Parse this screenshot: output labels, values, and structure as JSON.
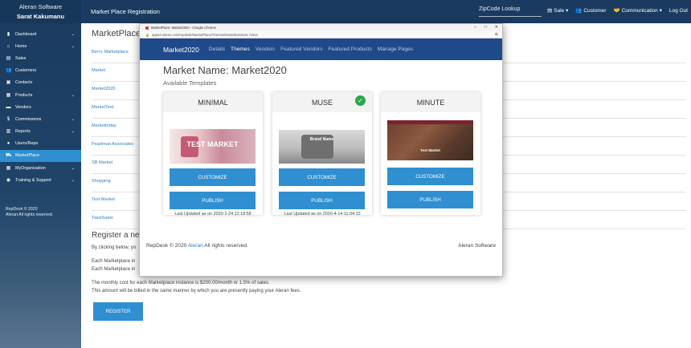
{
  "sidebar": {
    "app_name": "Aleran Software",
    "user_name": "Sarat Kakumanu",
    "items": [
      {
        "label": "Dashboard",
        "icon": "bar-chart-icon",
        "chevron": true
      },
      {
        "label": "Home",
        "icon": "home-icon",
        "chevron": true
      },
      {
        "label": "Sales",
        "icon": "document-icon",
        "chevron": false
      },
      {
        "label": "Customers",
        "icon": "users-icon",
        "chevron": false
      },
      {
        "label": "Contacts",
        "icon": "contact-icon",
        "chevron": false
      },
      {
        "label": "Products",
        "icon": "box-icon",
        "chevron": true
      },
      {
        "label": "Vendors",
        "icon": "truck-icon",
        "chevron": false
      },
      {
        "label": "Commissions",
        "icon": "dollar-icon",
        "chevron": true
      },
      {
        "label": "Reports",
        "icon": "reports-icon",
        "chevron": true
      },
      {
        "label": "Users/Reps",
        "icon": "user-icon",
        "chevron": false
      },
      {
        "label": "MarketPlace",
        "icon": "cart-icon",
        "chevron": false,
        "active": true
      },
      {
        "label": "MyOrganization",
        "icon": "building-icon",
        "chevron": true
      },
      {
        "label": "Training & Support",
        "icon": "support-icon",
        "chevron": true
      }
    ],
    "footer_line1": "RepDesk © 2020",
    "footer_line2": "Aleran All rights reserved."
  },
  "topbar": {
    "title": "Market Place Registration",
    "search_value": "ZipCode Lookup",
    "menu": {
      "sale": "Sale",
      "customer": "Customer",
      "communication": "Communication",
      "logout": "Log Out"
    }
  },
  "background": {
    "title": "MarketPlaces",
    "rows": [
      "Ben's Marketplace",
      "Market",
      "Market2020",
      "MarketTest",
      "Markettoday",
      "Pearlman Associates",
      "SB Market",
      "Shopping",
      "Test Market",
      "TwistSalon"
    ],
    "register_title": "Register a new",
    "line_click": "By clicking below, yo",
    "line_each1": "Each Marketplace in",
    "line_each2": "Each Marketplace in",
    "cost_line1": "The monthly cost for each Marketplace instance is $200.00/month or 1.5% of sales.",
    "cost_line2": "This amount will be billed in the same manner by which you are presently paying your Aleran fees.",
    "register_button": "REGISTER"
  },
  "popup": {
    "window_title": "MarketPlace: Market2020 - Google Chrome",
    "address": "apps2.aleran.com/repdesk/MarketPlace/Themes/534405344434.71912",
    "nav": {
      "brand": "Market2020",
      "links": [
        "Details",
        "Themes",
        "Vendors",
        "Featured Vendors",
        "Featured Products",
        "Manage Pages"
      ],
      "active": "Themes"
    },
    "market_name": "Market Name: Market2020",
    "available": "Available Templates",
    "templates": [
      {
        "name": "MINIMAL",
        "thumb_text": "TEST MARKET",
        "customize": "CUSTOMIZE",
        "publish": "PUBLISH",
        "updated": "Last Updated as on 2020-1-24 12:18:58",
        "selected": false
      },
      {
        "name": "MUSE",
        "thumb_text": "Brand Name",
        "customize": "CUSTOMIZE",
        "publish": "PUBLISH",
        "updated": "Last Updated as on 2020-4-14 11:34:10",
        "selected": true
      },
      {
        "name": "MINUTE",
        "thumb_text": "Test Market",
        "customize": "CUSTOMIZE",
        "publish": "PUBLISH",
        "updated": "",
        "selected": false
      }
    ],
    "footer_prefix": "RepDesk © 2020 ",
    "footer_link": "Aleran",
    "footer_suffix": " All rights reserved.",
    "footer_right": "Aleran Software"
  }
}
